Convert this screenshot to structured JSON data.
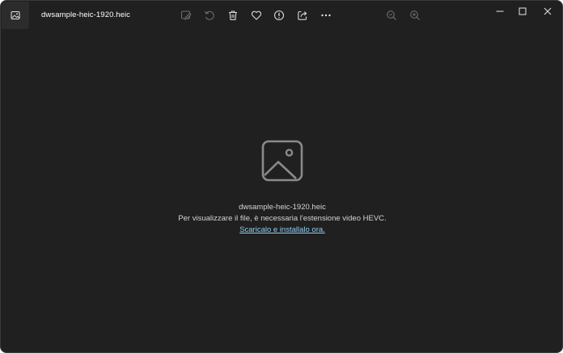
{
  "titlebar": {
    "file_name": "dwsample-heic-1920.heic",
    "app_icon": "photo-app-icon"
  },
  "toolbar": {
    "items": [
      {
        "icon": "edit-image-icon",
        "enabled": false
      },
      {
        "icon": "rotate-icon",
        "enabled": false
      },
      {
        "icon": "delete-icon",
        "enabled": true
      },
      {
        "icon": "favorite-icon",
        "enabled": true
      },
      {
        "icon": "info-icon",
        "enabled": true
      },
      {
        "icon": "share-icon",
        "enabled": true
      },
      {
        "icon": "more-icon",
        "enabled": true
      },
      {
        "icon": "zoom-out-icon",
        "enabled": false
      },
      {
        "icon": "zoom-in-icon",
        "enabled": false
      }
    ]
  },
  "window_controls": [
    "minimize-icon",
    "maximize-icon",
    "close-icon"
  ],
  "message": {
    "file_name": "dwsample-heic-1920.heic",
    "info": "Per visualizzare il file, è necessaria l'estensione video HEVC.",
    "link": "Scaricalo e installalo ora."
  },
  "colors": {
    "background": "#202020",
    "text": "#d4d4d4",
    "link": "#8fd0f0",
    "icon": "#cfcfcf",
    "icon_disabled": "#6e6e6e"
  }
}
